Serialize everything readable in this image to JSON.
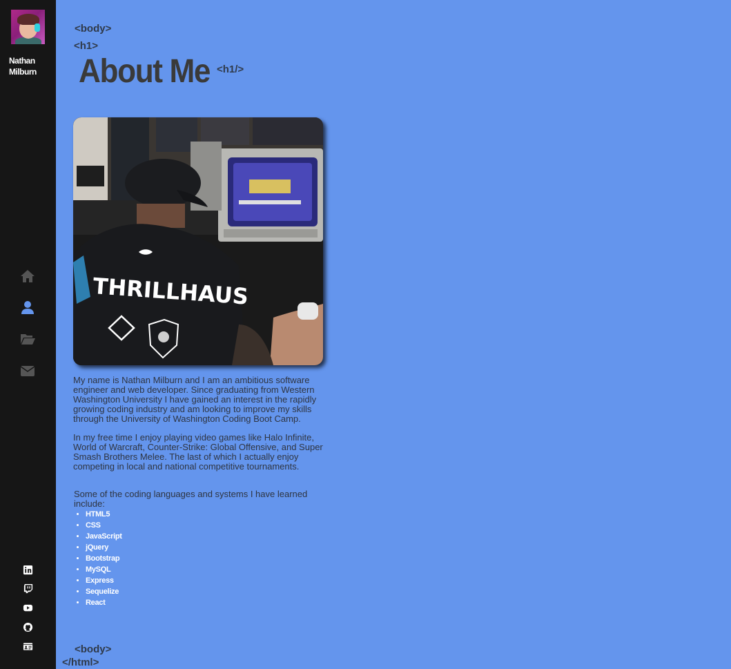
{
  "sidebar": {
    "name": "Nathan\nMilburn",
    "nav": [
      {
        "icon": "home-icon",
        "label": "Home",
        "active": false
      },
      {
        "icon": "user-icon",
        "label": "About",
        "active": true
      },
      {
        "icon": "folder-open-icon",
        "label": "Portfolio",
        "active": false
      },
      {
        "icon": "envelope-icon",
        "label": "Contact",
        "active": false
      }
    ],
    "social": [
      {
        "icon": "linkedin-icon"
      },
      {
        "icon": "twitch-icon"
      },
      {
        "icon": "youtube-icon"
      },
      {
        "icon": "github-icon"
      },
      {
        "icon": "resume-card-icon"
      }
    ]
  },
  "tags": {
    "body_open": "<body>",
    "h1_open": "<h1>",
    "h1_close": "<h1/>",
    "body_close": "<body>",
    "html_close": "</html>"
  },
  "heading": "About Me",
  "photo": {
    "jersey_text": "THRILLHAUS"
  },
  "paragraphs": [
    "My name is Nathan Milburn and I am an ambitious software engineer and web developer. Since graduating from Western Washington University I have gained an interest in the rapidly growing coding industry and am looking to improve my skills through the University of Washington Coding Boot Camp.",
    "In my free time I enjoy playing video games like Halo Infinite, World of Warcraft, Counter-Strike: Global Offensive, and Super Smash Brothers Melee. The last of which I actually enjoy competing in local and national competitive tournaments.",
    "Some of the coding languages and systems I have learned include:"
  ],
  "skills": [
    "HTML5",
    "CSS",
    "JavaScript",
    "jQuery",
    "Bootstrap",
    "MySQL",
    "Express",
    "Sequelize",
    "React"
  ],
  "colors": {
    "background": "#6495ED",
    "sidebar": "#161616",
    "nav_icon": "#555555",
    "nav_active": "#6495ED",
    "heading": "#3a3a3a"
  }
}
